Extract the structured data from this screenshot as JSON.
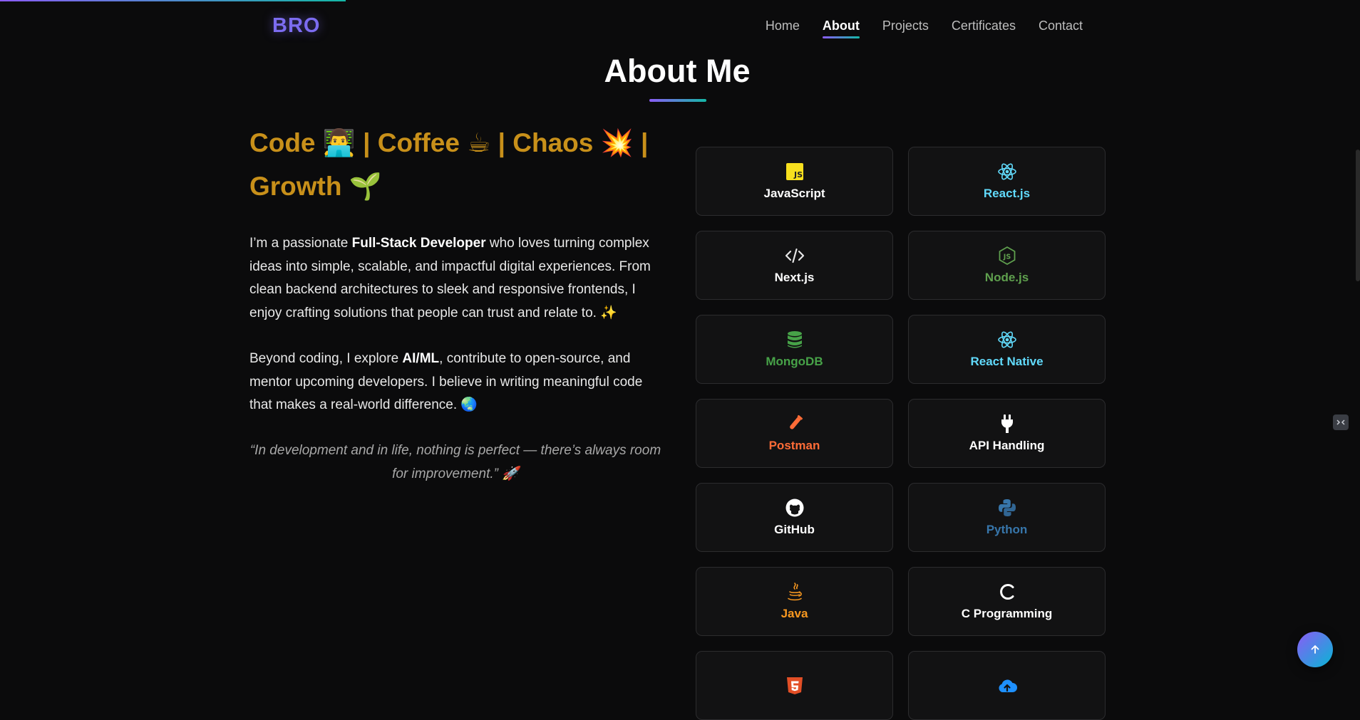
{
  "brand": {
    "logo": "BRO"
  },
  "nav": {
    "items": [
      "Home",
      "About",
      "Projects",
      "Certificates",
      "Contact"
    ],
    "active": "About"
  },
  "section": {
    "title": "About Me"
  },
  "tagline": {
    "line1": [
      "Code",
      "|",
      "Coffee",
      "|",
      "Chaos",
      "|"
    ],
    "line2": "Growth"
  },
  "about": {
    "p1_a": "I’m a passionate ",
    "p1_b": "Full-Stack Developer",
    "p1_c": " who loves turning complex ideas into simple, scalable, and impactful digital experiences. From clean backend architectures to sleek and responsive frontends, I enjoy crafting solutions that people can trust and relate to.",
    "p1_emoji": "✨",
    "p2_a": "Beyond coding, I explore ",
    "p2_b": "AI/ML",
    "p2_c": ", contribute to open-source, and mentor upcoming developers. I believe in writing meaningful code that makes a real-world difference.",
    "p2_emoji": "🌏",
    "quote": "“In development and in life, nothing is perfect — there’s always room for improvement.”",
    "quote_emoji": "🚀"
  },
  "skills": [
    {
      "label": "JavaScript",
      "icon": "javascript-icon",
      "color": "#ffffff",
      "icon_color": "#f7df1e"
    },
    {
      "label": "React.js",
      "icon": "react-icon",
      "color": "#61dafb",
      "icon_color": "#61dafb"
    },
    {
      "label": "Next.js",
      "icon": "code-brackets-icon",
      "color": "#ffffff",
      "icon_color": "#e5e5e5"
    },
    {
      "label": "Node.js",
      "icon": "nodejs-icon",
      "color": "#5fa04e",
      "icon_color": "#5fa04e"
    },
    {
      "label": "MongoDB",
      "icon": "database-icon",
      "color": "#47a248",
      "icon_color": "#47a248"
    },
    {
      "label": "React Native",
      "icon": "react-icon",
      "color": "#61dafb",
      "icon_color": "#61dafb"
    },
    {
      "label": "Postman",
      "icon": "test-tube-icon",
      "color": "#ff6c37",
      "icon_color": "#ff6c37"
    },
    {
      "label": "API Handling",
      "icon": "plug-icon",
      "color": "#ffffff",
      "icon_color": "#ffffff"
    },
    {
      "label": "GitHub",
      "icon": "github-icon",
      "color": "#ffffff",
      "icon_color": "#ffffff"
    },
    {
      "label": "Python",
      "icon": "python-icon",
      "color": "#3776ab",
      "icon_color": "#3776ab"
    },
    {
      "label": "Java",
      "icon": "java-icon",
      "color": "#f89820",
      "icon_color": "#f89820"
    },
    {
      "label": "C Programming",
      "icon": "c-icon",
      "color": "#ffffff",
      "icon_color": "#ffffff"
    },
    {
      "label": "",
      "icon": "html5-icon",
      "color": "#e34f26",
      "icon_color": "#e34f26"
    },
    {
      "label": "",
      "icon": "cloud-upload-icon",
      "color": "#1e90ff",
      "icon_color": "#1e90ff"
    }
  ],
  "colors": {
    "accent_start": "#8b5cf6",
    "accent_end": "#14b8a6",
    "tagline": "#c8901a"
  }
}
